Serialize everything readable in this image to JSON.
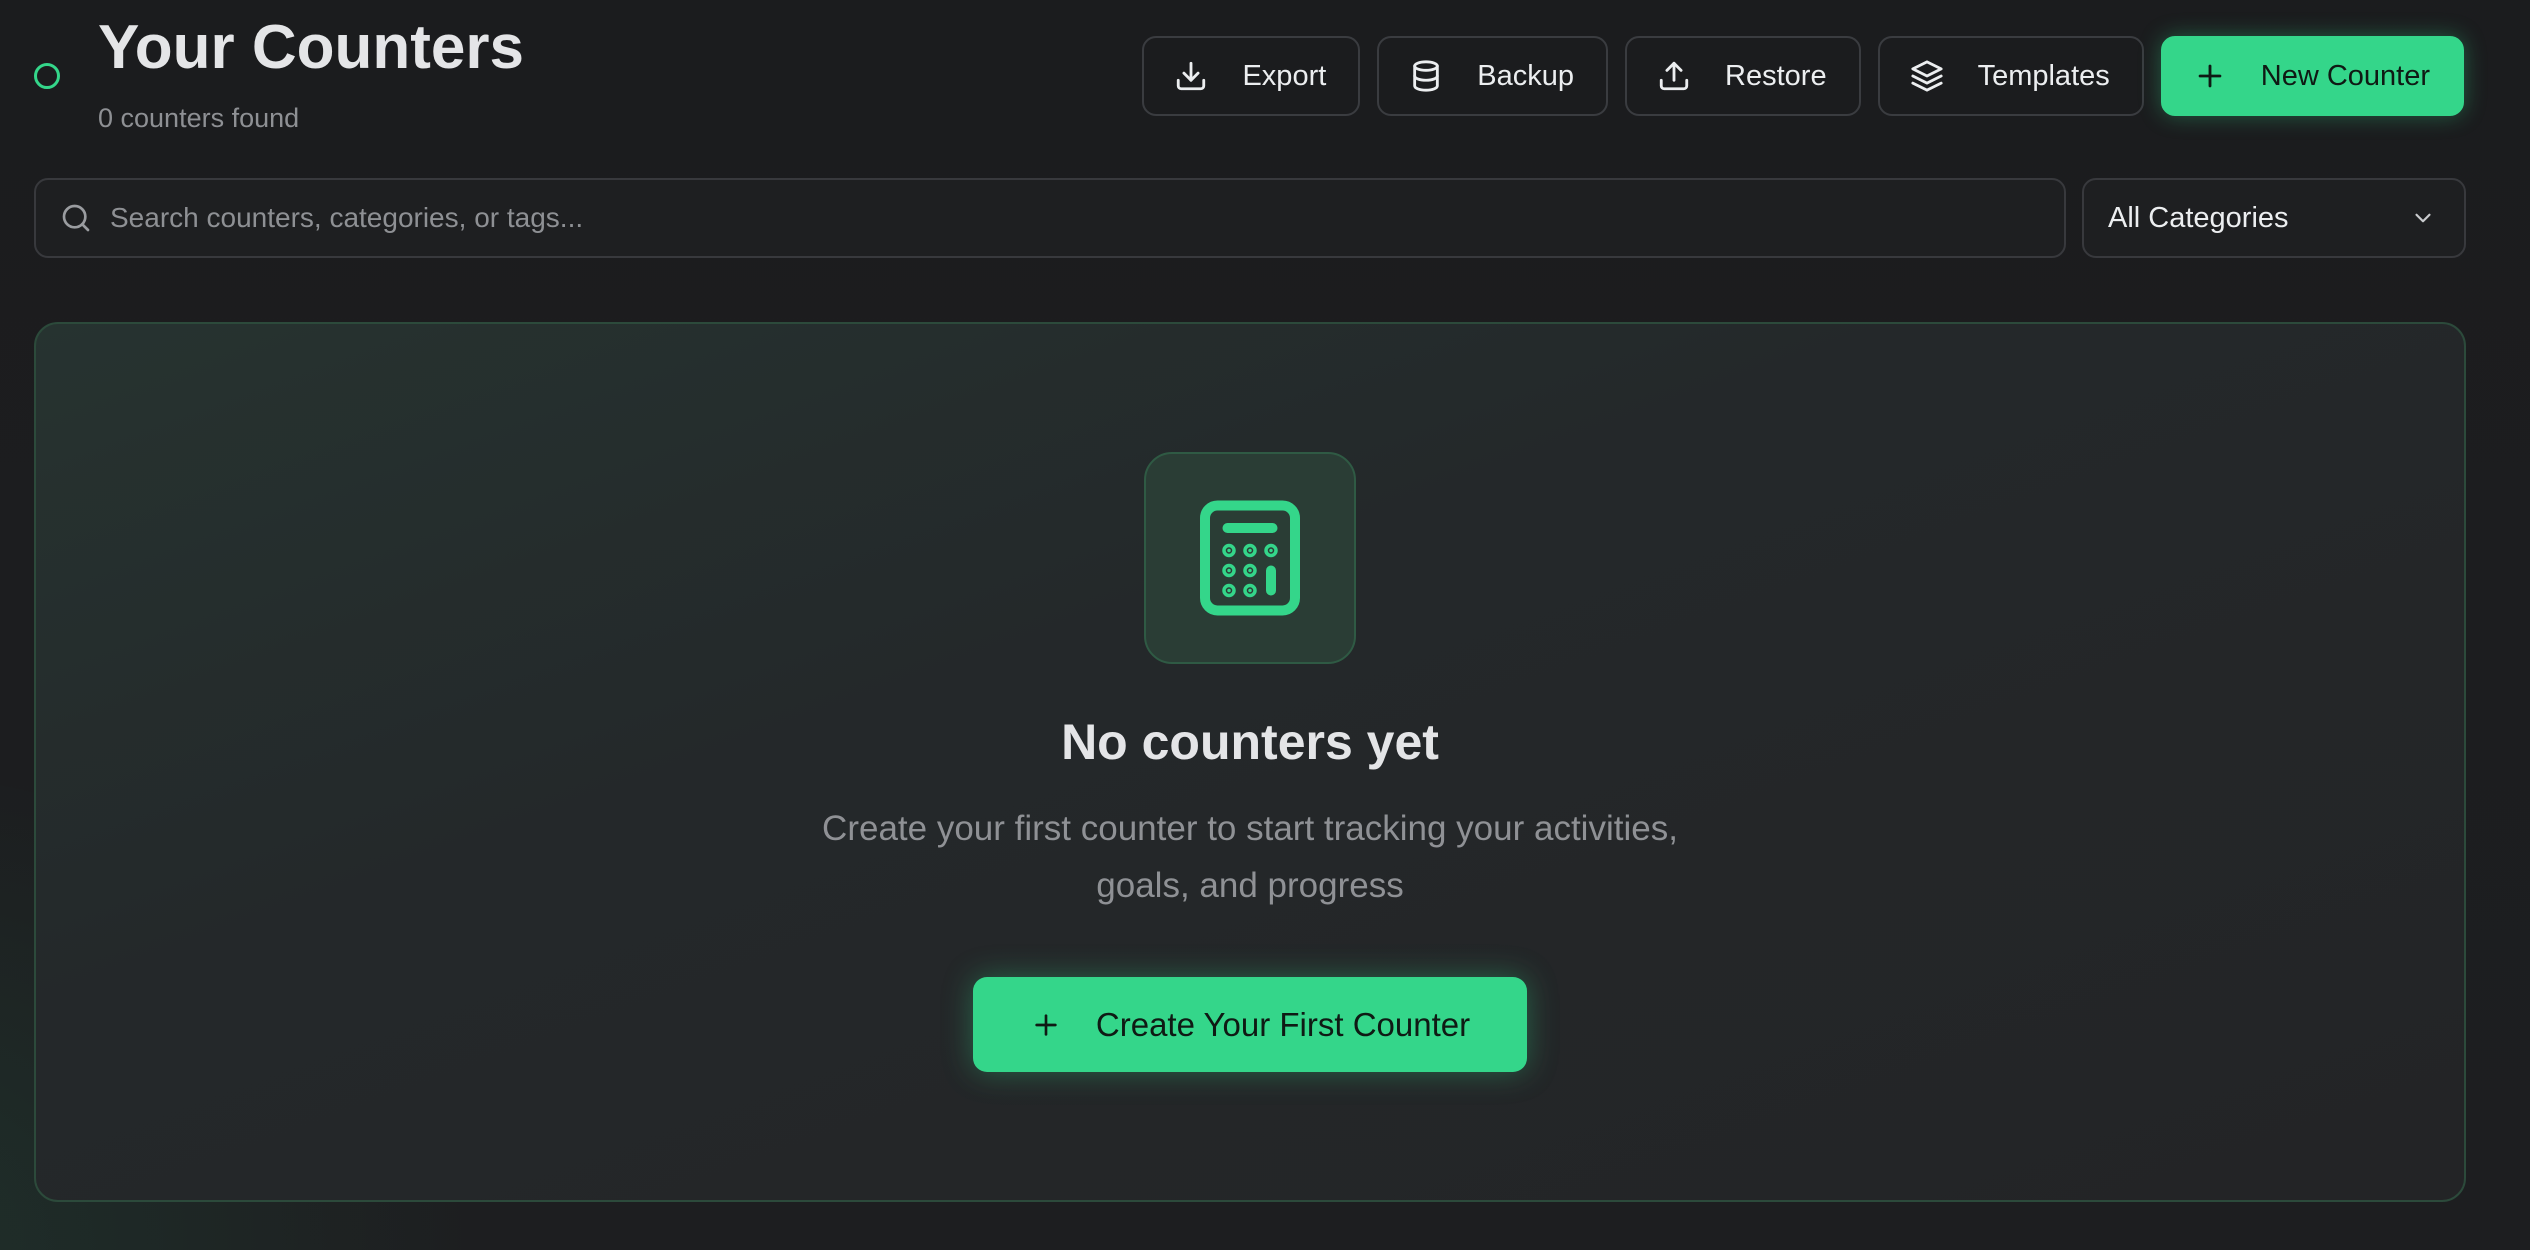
{
  "header": {
    "title": "Your Counters",
    "subtitle": "0 counters found"
  },
  "toolbar": {
    "buttons": [
      {
        "label": "Export",
        "icon": "download-icon"
      },
      {
        "label": "Backup",
        "icon": "database-icon"
      },
      {
        "label": "Restore",
        "icon": "upload-icon"
      },
      {
        "label": "Templates",
        "icon": "layers-icon"
      },
      {
        "label": "New Counter",
        "icon": "plus-icon"
      }
    ]
  },
  "search": {
    "placeholder": "Search counters, categories, or tags...",
    "value": ""
  },
  "filter": {
    "selected": "All Categories"
  },
  "empty_state": {
    "icon": "calculator-icon",
    "title": "No counters yet",
    "description": "Create your first counter to start tracking your activities, goals, and progress",
    "cta_label": "Create Your First Counter"
  },
  "colors": {
    "accent": "#34d68a",
    "background": "#1c1d1f",
    "text_muted": "#8e9094"
  }
}
